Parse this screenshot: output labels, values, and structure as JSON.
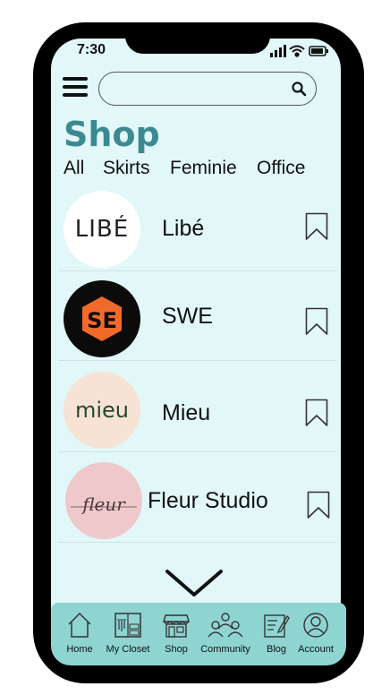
{
  "status_bar": {
    "time": "7:30"
  },
  "search": {
    "value": "",
    "placeholder": ""
  },
  "page": {
    "title": "Shop"
  },
  "filters": [
    "All",
    "Skirts",
    "Feminie",
    "Office"
  ],
  "shops": [
    {
      "name": "Libé",
      "logo_text": "LIBÉ",
      "logo_bg": "#ffffff"
    },
    {
      "name": "SWE",
      "logo_text": "SE",
      "logo_bg": "#0b0b0b"
    },
    {
      "name": "Mieu",
      "logo_text": "mieu",
      "logo_bg": "#f7e3d6"
    },
    {
      "name": "Fleur Studio",
      "logo_text": "fleur",
      "logo_bg": "#efc8cb"
    }
  ],
  "bottom_nav": [
    {
      "label": "Home",
      "icon": "home-icon"
    },
    {
      "label": "My Closet",
      "icon": "closet-icon"
    },
    {
      "label": "Shop",
      "icon": "shop-icon"
    },
    {
      "label": "Community",
      "icon": "community-icon"
    },
    {
      "label": "Blog",
      "icon": "blog-icon"
    },
    {
      "label": "Account",
      "icon": "account-icon"
    }
  ],
  "colors": {
    "accent": "#3b8a92",
    "screen_bg": "#e2f7f7",
    "nav_bg": "#8ed5d2",
    "swe_orange": "#f26a2a"
  }
}
